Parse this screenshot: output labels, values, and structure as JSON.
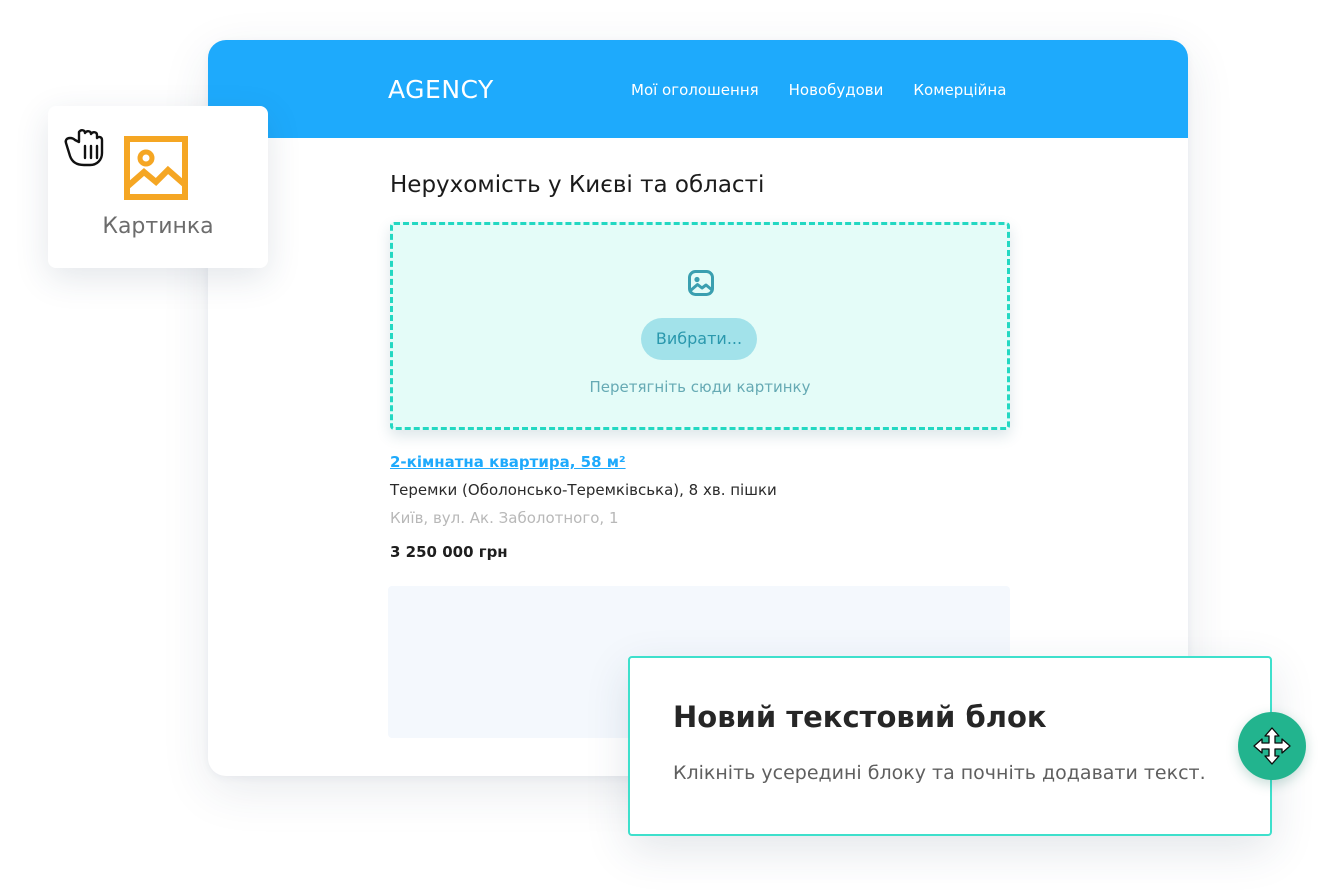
{
  "site": {
    "brand": "AGENCY",
    "nav": [
      {
        "label": "Мої оголошення"
      },
      {
        "label": "Новобудови"
      },
      {
        "label": "Комерційна"
      }
    ],
    "page_title": "Нерухомість у Києві та області"
  },
  "dropzone": {
    "icon": "image-icon",
    "button_label": "Вибрати...",
    "hint": "Перетягніть сюди картинку"
  },
  "listing": {
    "title": "2-кімнатна квартира, 58 м²",
    "metro": "Теремки (Оболонсько-Теремківська), 8 хв. пішки",
    "address": "Київ, вул. Ак. Заболотного, 1",
    "price": "3 250 000 грн"
  },
  "widget": {
    "icon": "image-icon",
    "label": "Картинка",
    "cursor_icon": "grab-hand-icon",
    "accent_color": "#f5a623"
  },
  "text_block": {
    "title": "Новий текстовий блок",
    "body": "Клікніть усередині блоку та почніть додавати текст.",
    "move_icon": "move-icon",
    "border_color": "#3ee0cc",
    "handle_color": "#22b48e"
  },
  "colors": {
    "header_blue": "#1eaafc",
    "dropzone_bg": "#e4fcf8",
    "dropzone_border": "#23d8c2"
  }
}
